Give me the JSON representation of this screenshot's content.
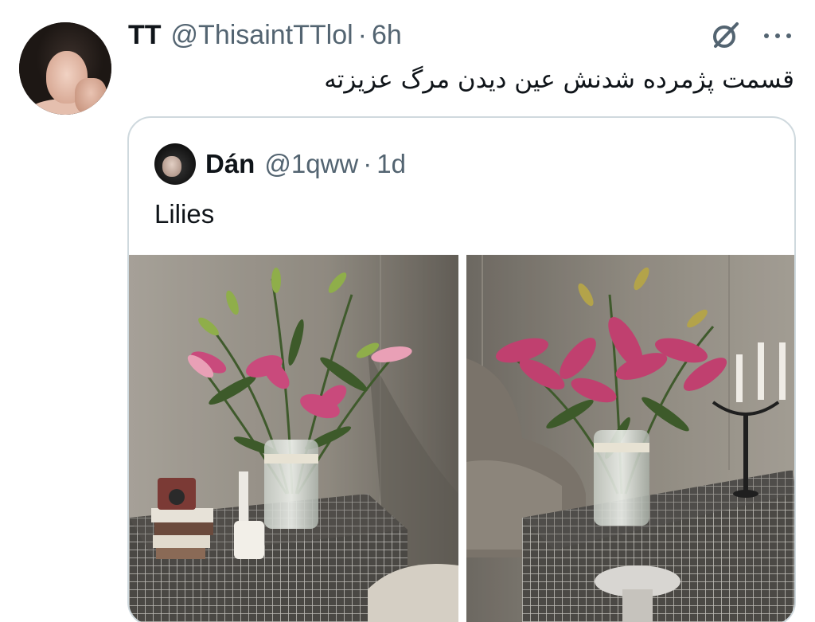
{
  "tweet": {
    "display_name": "TT",
    "handle": "@ThisaintTTlol",
    "separator": "·",
    "time": "6h",
    "text": "قسمت پژمرده شدنش عین دیدن مرگ عزیزته",
    "icons": [
      "grok-icon",
      "more-icon"
    ]
  },
  "quote": {
    "display_name": "Dán",
    "handle": "@1qww",
    "separator": "·",
    "time": "1d",
    "text": "Lilies",
    "photos": [
      "lilies-vase-photo-1",
      "lilies-vase-photo-2"
    ]
  },
  "colors": {
    "text_primary": "#0f1419",
    "text_secondary": "#536471",
    "border": "#cfd9de"
  }
}
